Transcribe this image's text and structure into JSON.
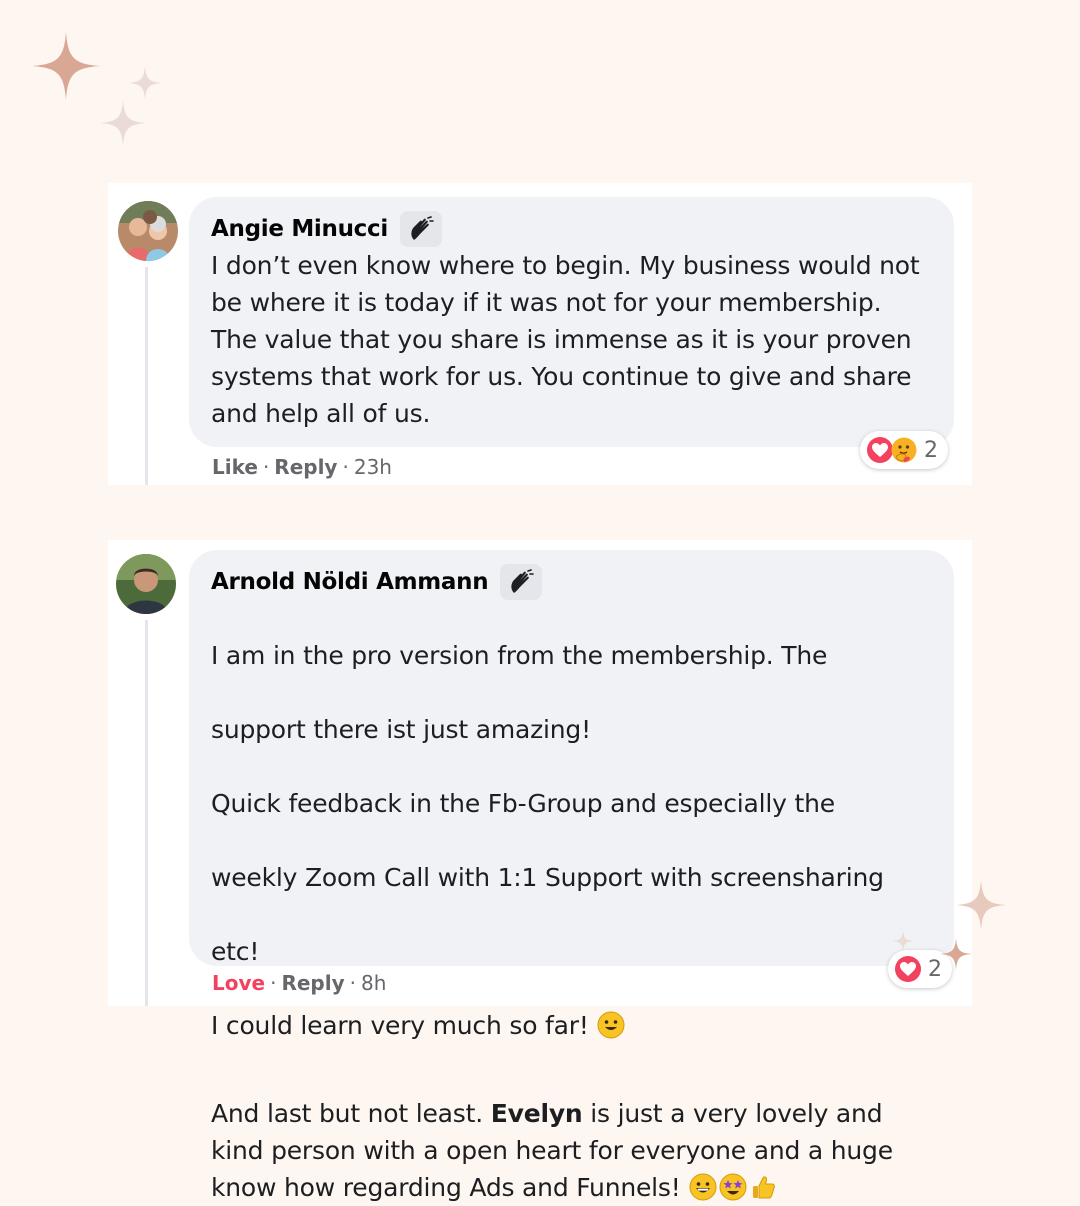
{
  "colors": {
    "background": "#fdf6f1",
    "sparkle_primary": "#d9a894",
    "sparkle_light": "#eadbd6",
    "bubble": "#f0f2f5",
    "meta_text": "#65676b",
    "love": "#f3425f"
  },
  "comments": [
    {
      "author": "Angie Minucci",
      "badge_icon": "waving-hand-icon",
      "text": "I don’t even know where to begin. My business would not be where it is today if it was not for your membership. The value that you share is immense as it is your proven systems that work for us. You continue to give and share and help all of us.",
      "actions": {
        "like": "Like",
        "reply": "Reply",
        "time": "23h"
      },
      "reactions": {
        "icons": [
          "love-reaction-icon",
          "care-reaction-icon"
        ],
        "count": "2"
      }
    },
    {
      "author": "Arnold Nöldi Ammann",
      "badge_icon": "waving-hand-icon",
      "text_lines": [
        "I am in the pro version from the membership. The",
        "support there ist just amazing!",
        "Quick feedback in the Fb-Group and especially the",
        "weekly Zoom Call with 1:1 Support with screensharing",
        "etc!",
        "I could learn very much so far!"
      ],
      "p2_before": "And last but not least. ",
      "p2_bold": "Evelyn",
      "p2_after": " is just a very lovely and kind person with a open heart for everyone and a huge know how regarding Ads and Funnels!",
      "emojis": [
        "smiley-emoji-icon",
        "grinning-emoji-icon",
        "star-struck-emoji-icon",
        "thumbs-up-emoji-icon"
      ],
      "actions": {
        "like": "Love",
        "reply": "Reply",
        "time": "8h"
      },
      "reactions": {
        "icons": [
          "love-reaction-icon"
        ],
        "count": "2"
      }
    }
  ]
}
